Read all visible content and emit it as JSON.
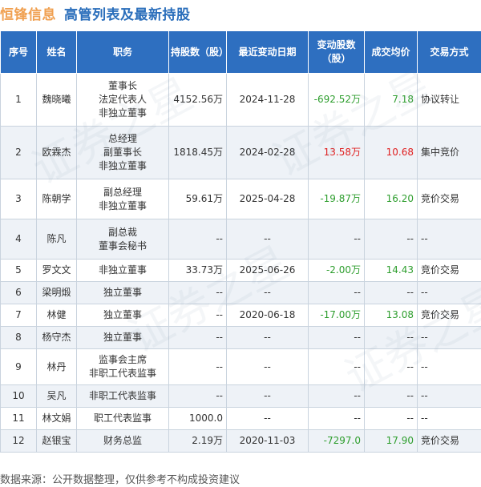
{
  "header": {
    "company": "恒锋信息",
    "title": "高管列表及最新持股"
  },
  "columns": [
    "序号",
    "姓名",
    "职务",
    "持股数（股）",
    "最近变动日期",
    "变动股数（股）",
    "成交均价",
    "交易方式"
  ],
  "rows": [
    {
      "no": "1",
      "name": "魏晓曦",
      "roles": [
        "董事长",
        "法定代表人",
        "非独立董事"
      ],
      "shares": "4152.56万",
      "date": "2024-11-28",
      "change": "-692.52万",
      "change_sign": "neg",
      "price": "7.18",
      "price_sign": "neg",
      "method": "协议转让"
    },
    {
      "no": "2",
      "name": "欧霖杰",
      "roles": [
        "总经理",
        "副董事长",
        "非独立董事"
      ],
      "shares": "1818.45万",
      "date": "2024-02-28",
      "change": "13.58万",
      "change_sign": "pos",
      "price": "10.68",
      "price_sign": "pos",
      "method": "集中竞价"
    },
    {
      "no": "3",
      "name": "陈朝学",
      "roles": [
        "副总经理",
        "非独立董事"
      ],
      "shares": "59.61万",
      "date": "2025-04-28",
      "change": "-19.87万",
      "change_sign": "neg",
      "price": "16.20",
      "price_sign": "neg",
      "method": "竞价交易"
    },
    {
      "no": "4",
      "name": "陈凡",
      "roles": [
        "副总裁",
        "董事会秘书"
      ],
      "shares": "--",
      "date": "--",
      "change": "--",
      "change_sign": "none",
      "price": "--",
      "price_sign": "none",
      "method": "--"
    },
    {
      "no": "5",
      "name": "罗文文",
      "roles": [
        "非独立董事"
      ],
      "shares": "33.73万",
      "date": "2025-06-26",
      "change": "-2.00万",
      "change_sign": "neg",
      "price": "14.43",
      "price_sign": "neg",
      "method": "竞价交易"
    },
    {
      "no": "6",
      "name": "梁明煅",
      "roles": [
        "独立董事"
      ],
      "shares": "--",
      "date": "--",
      "change": "--",
      "change_sign": "none",
      "price": "--",
      "price_sign": "none",
      "method": "--"
    },
    {
      "no": "7",
      "name": "林健",
      "roles": [
        "独立董事"
      ],
      "shares": "--",
      "date": "2020-06-18",
      "change": "-17.00万",
      "change_sign": "neg",
      "price": "13.08",
      "price_sign": "neg",
      "method": "竞价交易"
    },
    {
      "no": "8",
      "name": "杨守杰",
      "roles": [
        "独立董事"
      ],
      "shares": "--",
      "date": "--",
      "change": "--",
      "change_sign": "none",
      "price": "--",
      "price_sign": "none",
      "method": "--"
    },
    {
      "no": "9",
      "name": "林丹",
      "roles": [
        "监事会主席",
        "非职工代表监事"
      ],
      "shares": "--",
      "date": "--",
      "change": "--",
      "change_sign": "none",
      "price": "--",
      "price_sign": "none",
      "method": "--"
    },
    {
      "no": "10",
      "name": "吴凡",
      "roles": [
        "非职工代表监事"
      ],
      "shares": "--",
      "date": "--",
      "change": "--",
      "change_sign": "none",
      "price": "--",
      "price_sign": "none",
      "method": "--"
    },
    {
      "no": "11",
      "name": "林文娟",
      "roles": [
        "职工代表监事"
      ],
      "shares": "1000.0",
      "date": "--",
      "change": "--",
      "change_sign": "none",
      "price": "--",
      "price_sign": "none",
      "method": "--"
    },
    {
      "no": "12",
      "name": "赵银宝",
      "roles": [
        "财务总监"
      ],
      "shares": "2.19万",
      "date": "2020-11-03",
      "change": "-7297.0",
      "change_sign": "neg",
      "price": "17.90",
      "price_sign": "neg",
      "method": "竞价交易"
    }
  ],
  "watermark": "证券之星",
  "footer": "数据来源：公开数据整理，仅供参考不构成投资建议",
  "colors": {
    "company": "#f0a050",
    "title": "#2a6ebb",
    "header_bg": "#2e6fc0",
    "negative": "#2e9e2e",
    "positive": "#e02020"
  }
}
